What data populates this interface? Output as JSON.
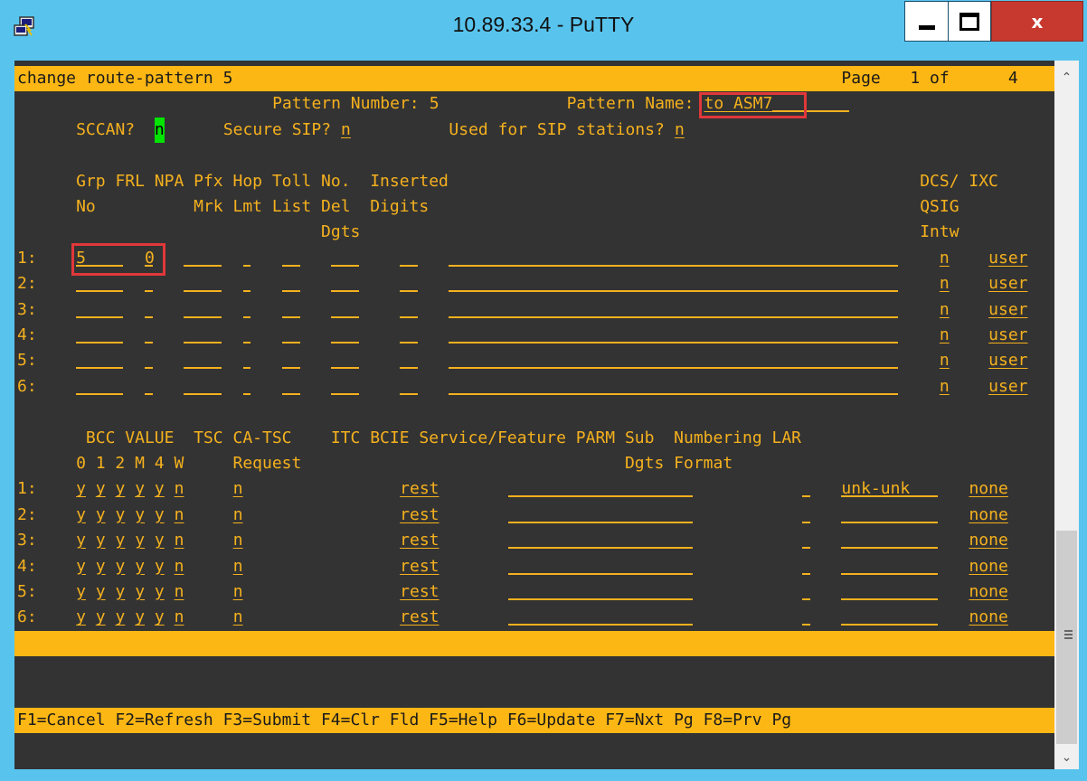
{
  "window": {
    "title": "10.89.33.4 - PuTTY",
    "minimize_label": "",
    "maximize_label": "",
    "close_label": "x"
  },
  "terminal": {
    "command": "change route-pattern 5",
    "page_label": "Page",
    "page_current": "1 of",
    "page_total": "4",
    "pattern_number_label": "Pattern Number:",
    "pattern_number": "5",
    "pattern_name_label": "Pattern Name:",
    "pattern_name": "to ASM7",
    "sccan_label": "SCCAN?",
    "sccan": "n",
    "secure_sip_label": "Secure SIP?",
    "secure_sip": "n",
    "sip_stations_label": "Used for SIP stations?",
    "sip_stations": "n",
    "trunk_header": [
      "Grp FRL NPA Pfx Hop Toll No.  Inserted",
      "No          Mrk Lmt List Del  Digits",
      "                         Dgts"
    ],
    "trunk_header_right": [
      "DCS/ IXC",
      "QSIG",
      "Intw"
    ],
    "trunk_rows": [
      {
        "num": "1:",
        "grp": "5",
        "frl": "0",
        "dcs": "n",
        "ixc": "user"
      },
      {
        "num": "2:",
        "grp": "",
        "frl": "",
        "dcs": "n",
        "ixc": "user"
      },
      {
        "num": "3:",
        "grp": "",
        "frl": "",
        "dcs": "n",
        "ixc": "user"
      },
      {
        "num": "4:",
        "grp": "",
        "frl": "",
        "dcs": "n",
        "ixc": "user"
      },
      {
        "num": "5:",
        "grp": "",
        "frl": "",
        "dcs": "n",
        "ixc": "user"
      },
      {
        "num": "6:",
        "grp": "",
        "frl": "",
        "dcs": "n",
        "ixc": "user"
      }
    ],
    "bcc_header": [
      "  BCC VALUE  TSC CA-TSC    ITC BCIE Service/Feature PARM Sub  Numbering LAR",
      " 0 1 2 M 4 W     Request                                 Dgts Format"
    ],
    "bcc_rows": [
      {
        "num": "1:",
        "bcc": [
          "y",
          "y",
          "y",
          "y",
          "y",
          "n"
        ],
        "tsc": "n",
        "itc": "rest",
        "numbering": "unk-unk",
        "lar": "none"
      },
      {
        "num": "2:",
        "bcc": [
          "y",
          "y",
          "y",
          "y",
          "y",
          "n"
        ],
        "tsc": "n",
        "itc": "rest",
        "numbering": "",
        "lar": "none"
      },
      {
        "num": "3:",
        "bcc": [
          "y",
          "y",
          "y",
          "y",
          "y",
          "n"
        ],
        "tsc": "n",
        "itc": "rest",
        "numbering": "",
        "lar": "none"
      },
      {
        "num": "4:",
        "bcc": [
          "y",
          "y",
          "y",
          "y",
          "y",
          "n"
        ],
        "tsc": "n",
        "itc": "rest",
        "numbering": "",
        "lar": "none"
      },
      {
        "num": "5:",
        "bcc": [
          "y",
          "y",
          "y",
          "y",
          "y",
          "n"
        ],
        "tsc": "n",
        "itc": "rest",
        "numbering": "",
        "lar": "none"
      },
      {
        "num": "6:",
        "bcc": [
          "y",
          "y",
          "y",
          "y",
          "y",
          "n"
        ],
        "tsc": "n",
        "itc": "rest",
        "numbering": "",
        "lar": "none"
      }
    ],
    "function_keys": "F1=Cancel F2=Refresh F3=Submit F4=Clr Fld F5=Help F6=Update F7=Nxt Pg F8=Prv Pg"
  },
  "colors": {
    "terminal_bg": "#333333",
    "terminal_fg": "#f5b11e",
    "status_bar": "#fdb714",
    "cursor": "#00e400",
    "highlight_box": "#e0383a",
    "titlebar": "#58c4ee"
  },
  "icons": {
    "app": "putty-icon",
    "scroll_up": "chevron-up-icon",
    "scroll_down": "chevron-down-icon"
  }
}
